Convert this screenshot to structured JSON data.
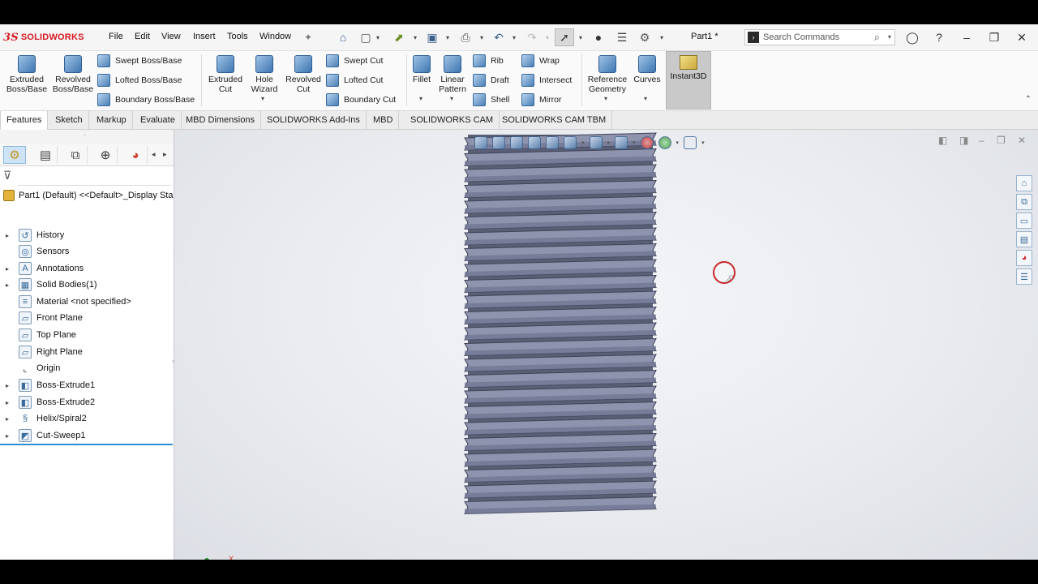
{
  "app": {
    "logo_prefix": "3S",
    "logo_text": "SOLIDWORKS",
    "document_title": "Part1 *"
  },
  "menu": [
    "File",
    "Edit",
    "View",
    "Insert",
    "Tools",
    "Window"
  ],
  "search": {
    "placeholder": "Search Commands"
  },
  "ribbon": {
    "extruded_boss": "Extruded Boss/Base",
    "revolved_boss": "Revolved Boss/Base",
    "swept_boss": "Swept Boss/Base",
    "lofted_boss": "Lofted Boss/Base",
    "boundary_boss": "Boundary Boss/Base",
    "extruded_cut": "Extruded Cut",
    "hole_wizard": "Hole Wizard",
    "revolved_cut": "Revolved Cut",
    "swept_cut": "Swept Cut",
    "lofted_cut": "Lofted Cut",
    "boundary_cut": "Boundary Cut",
    "fillet": "Fillet",
    "linear_pattern": "Linear Pattern",
    "rib": "Rib",
    "draft": "Draft",
    "shell": "Shell",
    "wrap": "Wrap",
    "intersect": "Intersect",
    "mirror": "Mirror",
    "reference_geometry": "Reference Geometry",
    "curves": "Curves",
    "instant3d": "Instant3D"
  },
  "tabs": [
    "Features",
    "Sketch",
    "Markup",
    "Evaluate",
    "MBD Dimensions",
    "SOLIDWORKS Add-Ins",
    "MBD",
    "SOLIDWORKS CAM",
    "SOLIDWORKS CAM TBM"
  ],
  "tree": {
    "root": "Part1 (Default) <<Default>_Display Sta",
    "items": [
      {
        "label": "History",
        "icon": "history-icon",
        "expandable": true
      },
      {
        "label": "Sensors",
        "icon": "sensors-icon",
        "expandable": false
      },
      {
        "label": "Annotations",
        "icon": "annotations-icon",
        "expandable": true
      },
      {
        "label": "Solid Bodies(1)",
        "icon": "solid-bodies-icon",
        "expandable": true
      },
      {
        "label": "Material <not specified>",
        "icon": "material-icon",
        "expandable": false
      },
      {
        "label": "Front Plane",
        "icon": "plane-icon",
        "expandable": false
      },
      {
        "label": "Top Plane",
        "icon": "plane-icon",
        "expandable": false
      },
      {
        "label": "Right Plane",
        "icon": "plane-icon",
        "expandable": false
      },
      {
        "label": "Origin",
        "icon": "origin-icon",
        "expandable": false
      },
      {
        "label": "Boss-Extrude1",
        "icon": "boss-extrude-icon",
        "expandable": true
      },
      {
        "label": "Boss-Extrude2",
        "icon": "boss-extrude-icon",
        "expandable": true
      },
      {
        "label": "Helix/Spiral2",
        "icon": "helix-icon",
        "expandable": true
      },
      {
        "label": "Cut-Sweep1",
        "icon": "cut-sweep-icon",
        "expandable": true
      }
    ]
  },
  "viewport": {
    "triad_x_label": "X"
  },
  "colors": {
    "brand": "#d71920",
    "thread_light": "#8e94ad",
    "thread_dark": "#3f4358",
    "rollback_bar": "#2b8fd6"
  }
}
